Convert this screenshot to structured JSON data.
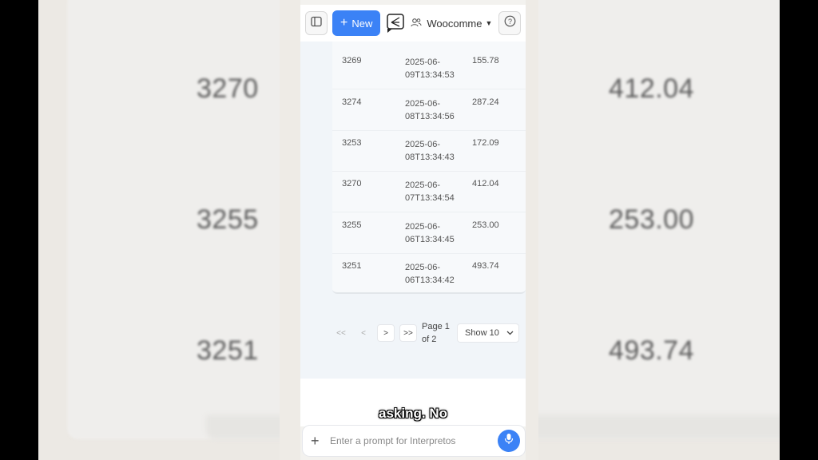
{
  "background": {
    "left_values": [
      "3270",
      "3255",
      "3251"
    ],
    "right_values": [
      "412.04",
      "253.00",
      "493.74"
    ]
  },
  "topbar": {
    "new_label": "New",
    "workspace_label": "Woocomme"
  },
  "table": {
    "rows": [
      {
        "id": "3269",
        "date": "2025-06-09T13:34:53",
        "amount": "155.78"
      },
      {
        "id": "3274",
        "date": "2025-06-08T13:34:56",
        "amount": "287.24"
      },
      {
        "id": "3253",
        "date": "2025-06-08T13:34:43",
        "amount": "172.09"
      },
      {
        "id": "3270",
        "date": "2025-06-07T13:34:54",
        "amount": "412.04"
      },
      {
        "id": "3255",
        "date": "2025-06-06T13:34:45",
        "amount": "253.00"
      },
      {
        "id": "3251",
        "date": "2025-06-06T13:34:42",
        "amount": "493.74"
      }
    ]
  },
  "pagination": {
    "first": "<<",
    "prev": "<",
    "next": ">",
    "last": ">>",
    "page_line1": "Page 1",
    "page_line2": "of 2",
    "show_label": "Show 10"
  },
  "caption": "asking. No",
  "prompt": {
    "placeholder": "Enter a prompt for Interpretos"
  },
  "colors": {
    "accent": "#3b82f6"
  }
}
